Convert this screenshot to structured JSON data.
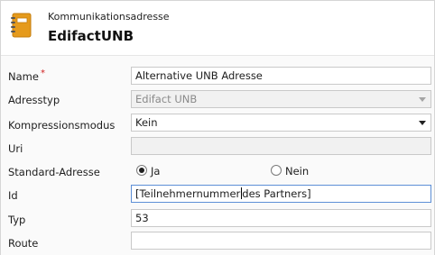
{
  "header": {
    "subtitle": "Kommunikationsadresse",
    "title": "EdifactUNB",
    "icon": "notebook-icon"
  },
  "form": {
    "name": {
      "label": "Name",
      "required_mark": "*",
      "value": "Alternative UNB Adresse"
    },
    "adresstyp": {
      "label": "Adresstyp",
      "value": "Edifact UNB"
    },
    "kompressionsmodus": {
      "label": "Kompressionsmodus",
      "value": "Kein"
    },
    "uri": {
      "label": "Uri",
      "value": ""
    },
    "standard_adresse": {
      "label": "Standard-Adresse",
      "options": [
        {
          "label": "Ja",
          "checked": true
        },
        {
          "label": "Nein",
          "checked": false
        }
      ]
    },
    "id": {
      "label": "Id",
      "value_before_cursor": "[Teilnehmernummer",
      "value_after_cursor": "des Partners]"
    },
    "typ": {
      "label": "Typ",
      "value": "53"
    },
    "route": {
      "label": "Route",
      "value": ""
    }
  },
  "colors": {
    "icon_orange": "#e59a1c",
    "focus_border": "#5d8fd6",
    "required": "#d02020"
  }
}
